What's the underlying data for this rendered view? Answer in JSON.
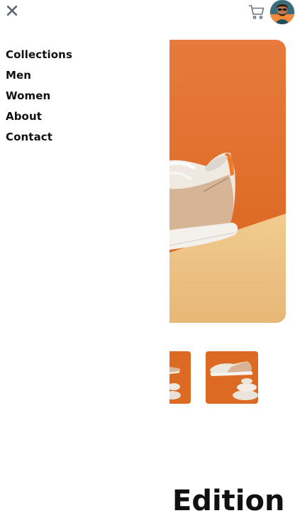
{
  "header": {
    "close_icon": "close-icon",
    "cart_icon": "cart-icon",
    "avatar_icon": "user-avatar"
  },
  "menu": {
    "items": [
      {
        "label": "Collections"
      },
      {
        "label": "Men"
      },
      {
        "label": "Women"
      },
      {
        "label": "About"
      },
      {
        "label": "Contact"
      }
    ]
  },
  "product": {
    "heading": "Edition"
  },
  "colors": {
    "accent_orange": "#e0651f",
    "sand": "#eec38a",
    "text": "#111111",
    "icon_gray": "#6b7280"
  }
}
